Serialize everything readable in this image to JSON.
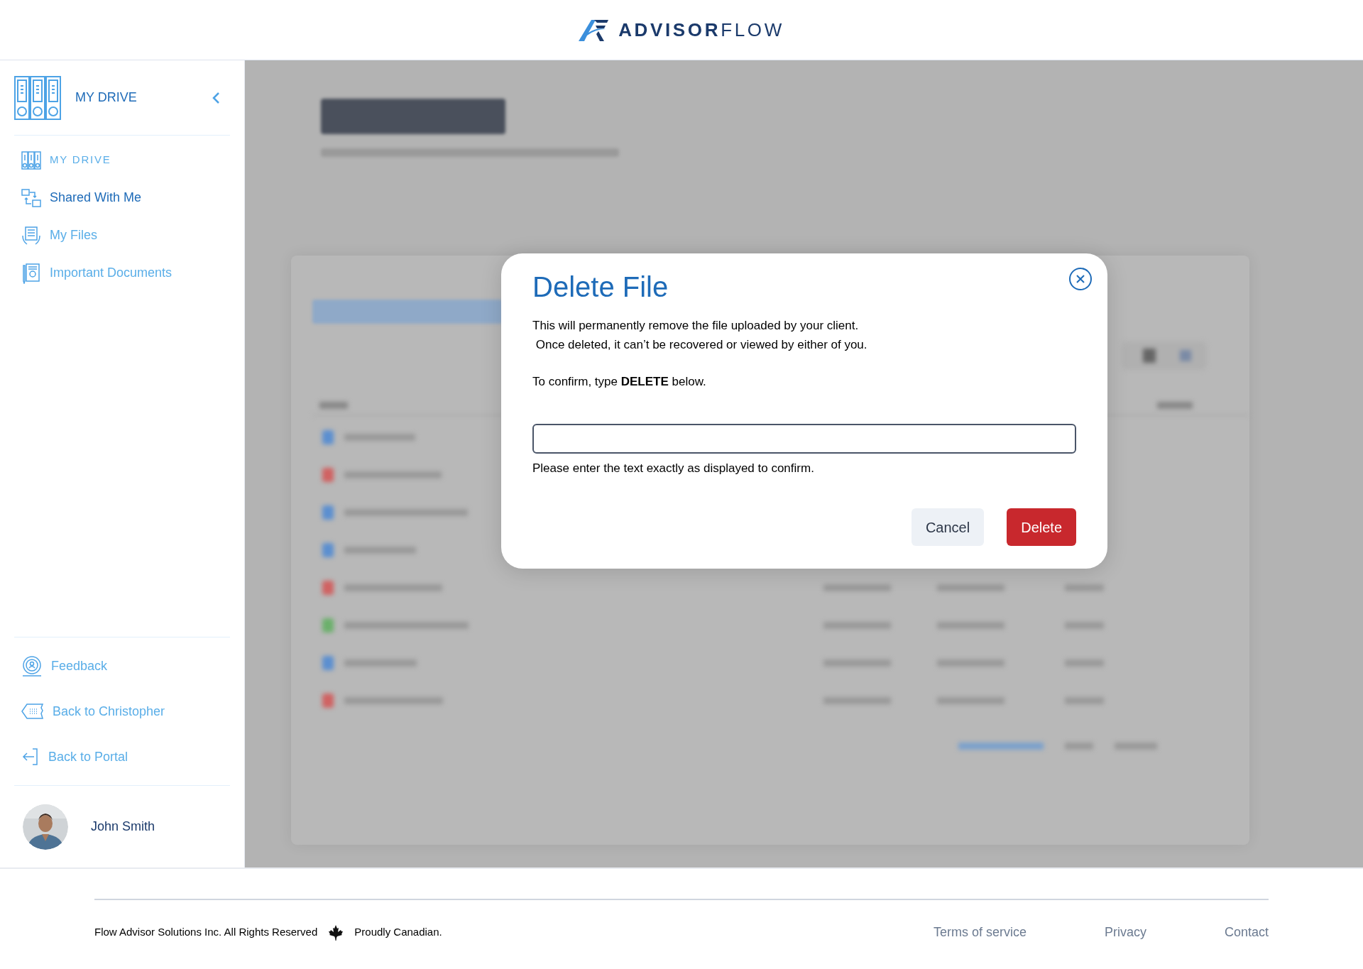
{
  "header": {
    "logo_text": "**ADVISOR**FLOW"
  },
  "sidebar": {
    "title": "MY DRIVE",
    "items": [
      {
        "label": "MY DRIVE",
        "kind": "section",
        "selected": false
      },
      {
        "label": "Shared With Me",
        "kind": "link",
        "selected": true
      },
      {
        "label": "My Files",
        "kind": "link",
        "selected": false
      },
      {
        "label": "Important Documents",
        "kind": "link",
        "selected": false
      }
    ],
    "bottom_items": [
      {
        "label": "Feedback"
      },
      {
        "label": "Back to Christopher"
      },
      {
        "label": "Back to Portal"
      }
    ],
    "user": {
      "name": "John Smith"
    }
  },
  "dialog": {
    "title": "Delete File",
    "message": "This will permanently remove the file uploaded by your client.\n Once deleted, it can’t be recovered or viewed by either of you.",
    "confirm_prompt": "To confirm, type **DELETE** below.",
    "hint": "Please enter the text exactly as displayed to confirm.",
    "buttons": [
      {
        "label": "Cancel",
        "kind": "secondary"
      },
      {
        "label": "Delete",
        "kind": "danger"
      }
    ]
  },
  "footer": {
    "copyright": "Flow Advisor Solutions Inc. All Rights Reserved",
    "tagline": "Proudly Canadian.",
    "links": [
      "Terms of service",
      "Privacy",
      "Contact"
    ]
  }
}
